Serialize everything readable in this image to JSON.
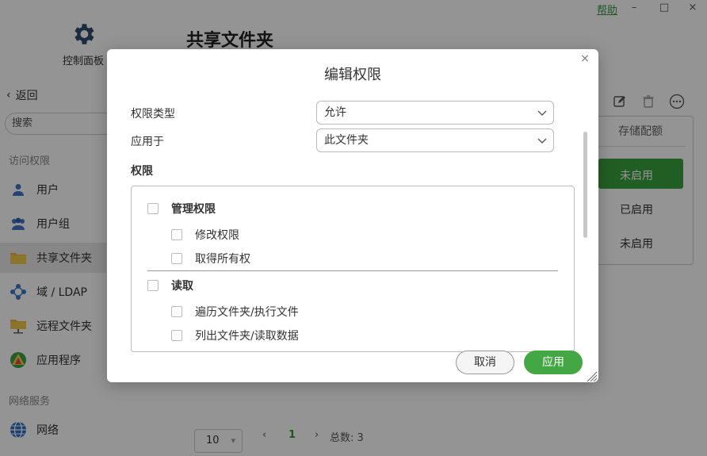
{
  "app": {
    "title": "共享文件夹",
    "control_panel_label": "控制面板",
    "help_link": "帮助",
    "window_controls": {
      "minimize": "–",
      "maximize": "□",
      "close": "×"
    }
  },
  "sidebar": {
    "back_label": "返回",
    "search_placeholder": "搜索",
    "sections": [
      {
        "title": "访问权限"
      },
      {
        "title": "网络服务"
      }
    ],
    "items": [
      {
        "label": "用户",
        "icon": "user-icon"
      },
      {
        "label": "用户组",
        "icon": "user-group-icon"
      },
      {
        "label": "共享文件夹",
        "icon": "folder-icon",
        "active": true
      },
      {
        "label": "域 / LDAP",
        "icon": "domain-icon"
      },
      {
        "label": "远程文件夹",
        "icon": "remote-folder-icon"
      },
      {
        "label": "应用程序",
        "icon": "app-icon"
      },
      {
        "label": "网络",
        "icon": "network-icon"
      }
    ]
  },
  "main": {
    "toolbar_icons": [
      "edit-icon",
      "delete-icon",
      "more-icon"
    ],
    "panel_header": "存储配额",
    "panel_rows": [
      "未启用",
      "已启用",
      "未启用"
    ],
    "pagination": {
      "page_size": "10",
      "current_page": "1",
      "total": "总数: 3"
    }
  },
  "dialog": {
    "title": "编辑权限",
    "permission_type_label": "权限类型",
    "permission_type_value": "允许",
    "apply_to_label": "应用于",
    "apply_to_value": "此文件夹",
    "permissions_heading": "权限",
    "groups": [
      {
        "label": "管理权限",
        "items": [
          "修改权限",
          "取得所有权"
        ]
      },
      {
        "label": "读取",
        "items": [
          "遍历文件夹/执行文件",
          "列出文件夹/读取数据"
        ]
      }
    ],
    "cancel_label": "取消",
    "apply_label": "应用"
  },
  "colors": {
    "accent_green": "#43a843",
    "help_green": "#2e9c3a"
  }
}
